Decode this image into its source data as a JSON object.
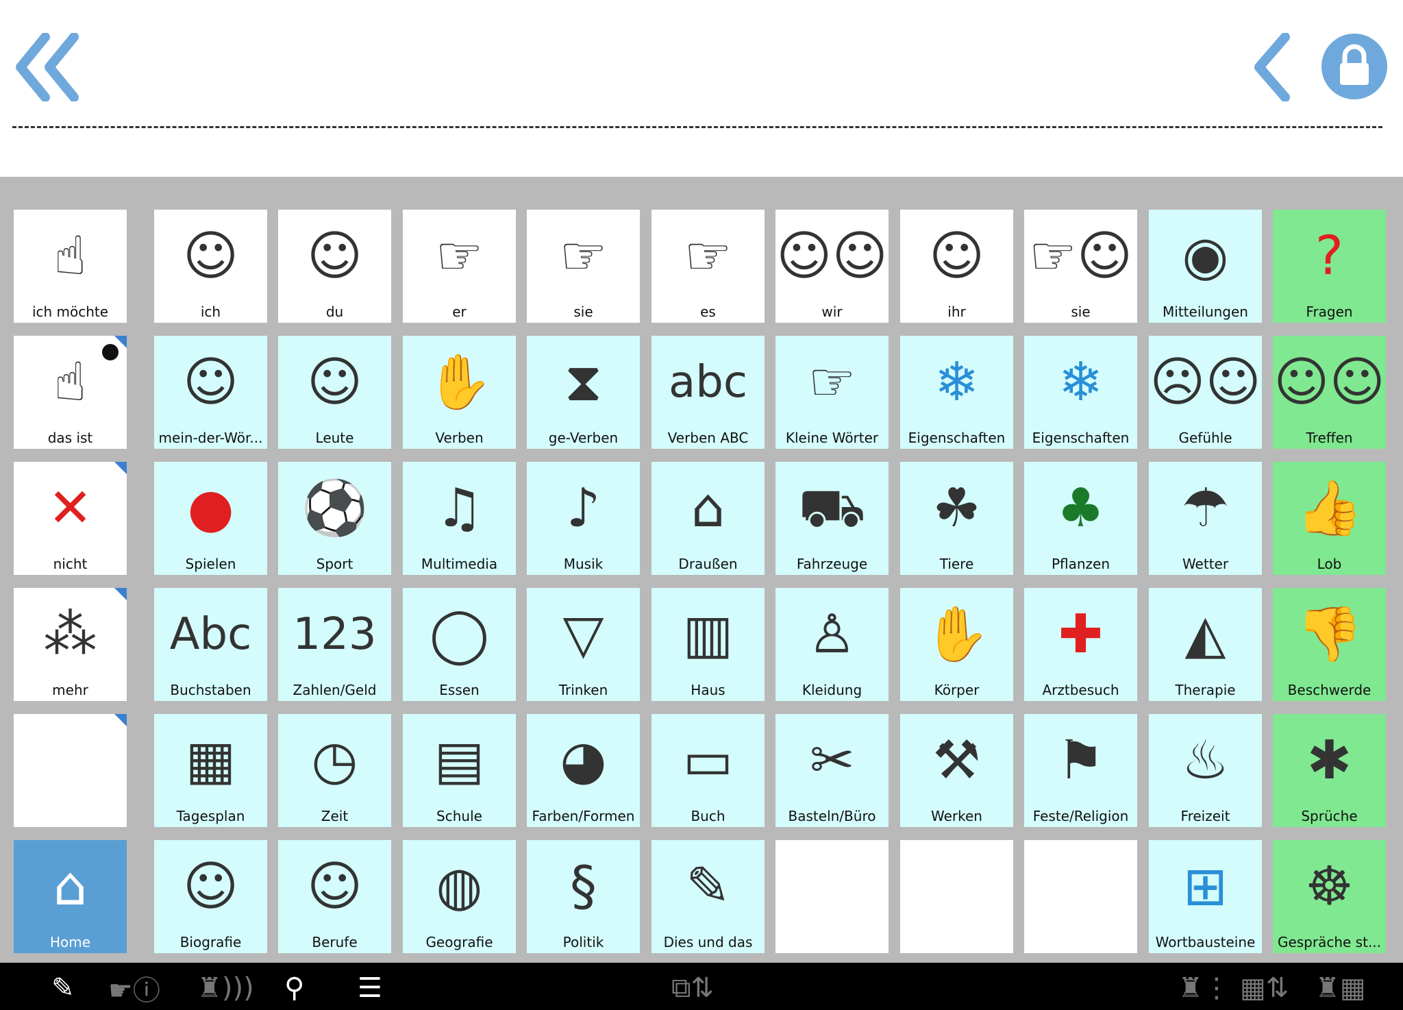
{
  "colors": {
    "white": "#ffffff",
    "cyan": "#d4fcfc",
    "green": "#80e890",
    "home": "#5a9fd4",
    "background": "#b9b9b9",
    "chevron": "#6fa8dc"
  },
  "toolbar_top": {
    "back_all": "double-chevron-left-icon",
    "back": "chevron-left-icon",
    "lock": "lock-icon"
  },
  "rows": [
    [
      {
        "label": "ich möchte",
        "t": "w",
        "icon": "person-want"
      },
      {
        "label": "ich",
        "t": "w",
        "icon": "person-me"
      },
      {
        "label": "du",
        "t": "w",
        "icon": "person-you"
      },
      {
        "label": "er",
        "t": "w",
        "icon": "boy-point"
      },
      {
        "label": "sie",
        "t": "w",
        "icon": "girl-point"
      },
      {
        "label": "es",
        "t": "w",
        "icon": "baby-point"
      },
      {
        "label": "wir",
        "t": "w",
        "icon": "people-we"
      },
      {
        "label": "ihr",
        "t": "w",
        "icon": "person-you-plural"
      },
      {
        "label": "sie",
        "t": "w",
        "icon": "people-they"
      },
      {
        "label": "Mitteilungen",
        "t": "c",
        "icon": "buzzer-button"
      },
      {
        "label": "Fragen",
        "t": "g",
        "icon": "question-mark"
      }
    ],
    [
      {
        "label": "das ist",
        "t": "w",
        "icon": "pointing-hand",
        "corner": true,
        "dot": true
      },
      {
        "label": "mein-der-Wör...",
        "t": "c",
        "icon": "people-group"
      },
      {
        "label": "Leute",
        "t": "c",
        "icon": "family"
      },
      {
        "label": "Verben",
        "t": "c",
        "icon": "verbs"
      },
      {
        "label": "ge-Verben",
        "t": "c",
        "icon": "hourglass-verbs"
      },
      {
        "label": "Verben ABC",
        "t": "c",
        "icon": "abc-verbs"
      },
      {
        "label": "Kleine Wörter",
        "t": "c",
        "icon": "small-words"
      },
      {
        "label": "Eigenschaften",
        "t": "c",
        "icon": "snowflake"
      },
      {
        "label": "Eigenschaften",
        "t": "c",
        "icon": "abc-snowflake"
      },
      {
        "label": "Gefühle",
        "t": "c",
        "icon": "faces-feelings"
      },
      {
        "label": "Treffen",
        "t": "g",
        "icon": "people-meet"
      }
    ],
    [
      {
        "label": "nicht",
        "t": "w",
        "icon": "red-x",
        "corner": true
      },
      {
        "label": "Spielen",
        "t": "c",
        "icon": "toys"
      },
      {
        "label": "Sport",
        "t": "c",
        "icon": "sport"
      },
      {
        "label": "Multimedia",
        "t": "c",
        "icon": "multimedia"
      },
      {
        "label": "Musik",
        "t": "c",
        "icon": "guitar"
      },
      {
        "label": "Draußen",
        "t": "c",
        "icon": "house-tree"
      },
      {
        "label": "Fahrzeuge",
        "t": "c",
        "icon": "vehicles"
      },
      {
        "label": "Tiere",
        "t": "c",
        "icon": "animals"
      },
      {
        "label": "Pflanzen",
        "t": "c",
        "icon": "plants"
      },
      {
        "label": "Wetter",
        "t": "c",
        "icon": "weather"
      },
      {
        "label": "Lob",
        "t": "g",
        "icon": "thumbs-up"
      }
    ],
    [
      {
        "label": "mehr",
        "t": "w",
        "icon": "more-dots",
        "corner": true
      },
      {
        "label": "Buchstaben",
        "t": "c",
        "icon": "abc-text"
      },
      {
        "label": "Zahlen/Geld",
        "t": "c",
        "icon": "123-text"
      },
      {
        "label": "Essen",
        "t": "c",
        "icon": "plate"
      },
      {
        "label": "Trinken",
        "t": "c",
        "icon": "glass"
      },
      {
        "label": "Haus",
        "t": "c",
        "icon": "furniture"
      },
      {
        "label": "Kleidung",
        "t": "c",
        "icon": "clothes"
      },
      {
        "label": "Körper",
        "t": "c",
        "icon": "washing-hand"
      },
      {
        "label": "Arztbesuch",
        "t": "c",
        "icon": "medical"
      },
      {
        "label": "Therapie",
        "t": "c",
        "icon": "therapy"
      },
      {
        "label": "Beschwerde",
        "t": "g",
        "icon": "thumbs-down"
      }
    ],
    [
      {
        "label": "",
        "t": "e",
        "icon": "",
        "corner": true
      },
      {
        "label": "Tagesplan",
        "t": "c",
        "icon": "weekdays"
      },
      {
        "label": "Zeit",
        "t": "c",
        "icon": "clock"
      },
      {
        "label": "Schule",
        "t": "c",
        "icon": "school"
      },
      {
        "label": "Farben/Formen",
        "t": "c",
        "icon": "colors"
      },
      {
        "label": "Buch",
        "t": "c",
        "icon": "book"
      },
      {
        "label": "Basteln/Büro",
        "t": "c",
        "icon": "scissors"
      },
      {
        "label": "Werken",
        "t": "c",
        "icon": "tools"
      },
      {
        "label": "Feste/Religion",
        "t": "c",
        "icon": "gift"
      },
      {
        "label": "Freizeit",
        "t": "c",
        "icon": "leisure"
      },
      {
        "label": "Sprüche",
        "t": "g",
        "icon": "speech-wow"
      }
    ],
    [
      {
        "label": "Home",
        "t": "b",
        "icon": "home"
      },
      {
        "label": "Biografie",
        "t": "c",
        "icon": "biography"
      },
      {
        "label": "Berufe",
        "t": "c",
        "icon": "jobs"
      },
      {
        "label": "Geografie",
        "t": "c",
        "icon": "globe"
      },
      {
        "label": "Politik",
        "t": "c",
        "icon": "politics"
      },
      {
        "label": "Dies und das",
        "t": "c",
        "icon": "misc"
      },
      {
        "label": "",
        "t": "e",
        "icon": ""
      },
      {
        "label": "",
        "t": "e",
        "icon": ""
      },
      {
        "label": "",
        "t": "e",
        "icon": ""
      },
      {
        "label": "Wortbausteine",
        "t": "c",
        "icon": "word-blocks"
      },
      {
        "label": "Gespräche st...",
        "t": "g",
        "icon": "speech-wheel"
      }
    ]
  ],
  "bottom_bar": {
    "left": [
      "pencil-icon",
      "hand-info-icon",
      "speaker-sound-icon",
      "search-icon",
      "list-icon"
    ],
    "center": [
      "page-resize-icon"
    ],
    "right": [
      "speaker-column-icon",
      "grid-resize-icon",
      "speaker-grid-icon"
    ]
  }
}
